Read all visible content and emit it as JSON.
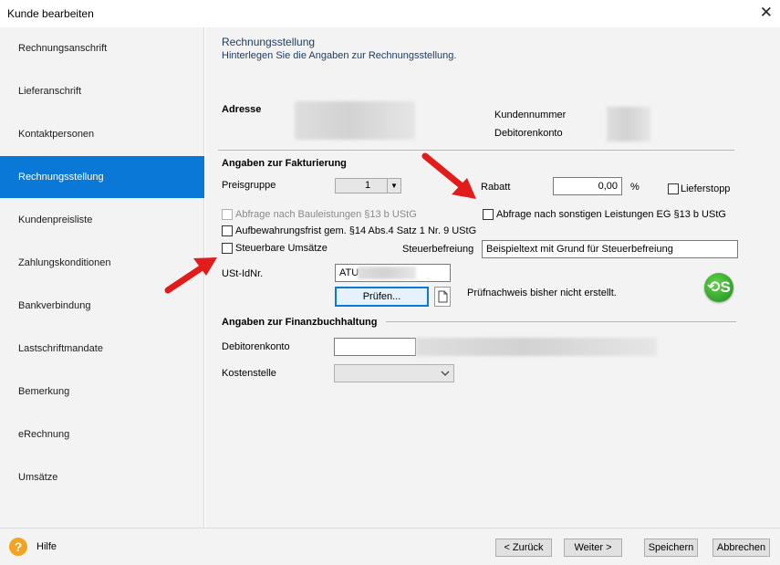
{
  "window": {
    "title": "Kunde bearbeiten",
    "close_glyph": "✕"
  },
  "sidebar": {
    "items": [
      {
        "label": "Rechnungsanschrift"
      },
      {
        "label": "Lieferanschrift"
      },
      {
        "label": "Kontaktpersonen"
      },
      {
        "label": "Rechnungsstellung",
        "active": true
      },
      {
        "label": "Kundenpreisliste"
      },
      {
        "label": "Zahlungskonditionen"
      },
      {
        "label": "Bankverbindung"
      },
      {
        "label": "Lastschriftmandate"
      },
      {
        "label": "Bemerkung"
      },
      {
        "label": "eRechnung"
      },
      {
        "label": "Umsätze"
      }
    ]
  },
  "header": {
    "title": "Rechnungsstellung",
    "subtitle": "Hinterlegen Sie die Angaben zur Rechnungsstellung."
  },
  "address": {
    "label": "Adresse",
    "kundennummer_label": "Kundennummer",
    "debitorenkonto_label": "Debitorenkonto"
  },
  "fakturierung": {
    "section_title": "Angaben zur Fakturierung",
    "preisgruppe_label": "Preisgruppe",
    "preisgruppe_value": "1",
    "rabatt_label": "Rabatt",
    "rabatt_value": "0,00",
    "rabatt_unit": "%",
    "lieferstopp_label": "Lieferstopp",
    "bauleistungen_label": "Abfrage nach Bauleistungen §13 b UStG",
    "sonstige_leistungen_label": "Abfrage nach sonstigen Leistungen EG §13 b UStG",
    "aufbewahrung_label": "Aufbewahrungsfrist gem. §14 Abs.4 Satz 1 Nr. 9 UStG",
    "steuerbare_label": "Steuerbare Umsätze",
    "steuerbefreiung_label": "Steuerbefreiung",
    "steuerbefreiung_value": "Beispieltext mit Grund für Steuerbefreiung",
    "ustid_label": "USt-IdNr.",
    "ustid_value": "ATU",
    "pruefen_button": "Prüfen...",
    "pruef_status": "Prüfnachweis bisher nicht erstellt.",
    "s_icon_glyph": "⟲S"
  },
  "finanzbuchhaltung": {
    "section_title": "Angaben zur Finanzbuchhaltung",
    "debitorenkonto_label": "Debitorenkonto",
    "kostenstelle_label": "Kostenstelle"
  },
  "footer": {
    "help_glyph": "?",
    "help_label": "Hilfe",
    "back_button": "< Zurück",
    "next_button": "Weiter >",
    "save_button": "Speichern",
    "cancel_button": "Abbrechen"
  },
  "colors": {
    "accent": "#0a78d7",
    "help_icon": "#f4a221",
    "s_icon": "#2ea52a",
    "arrow": "#e21b1b"
  }
}
